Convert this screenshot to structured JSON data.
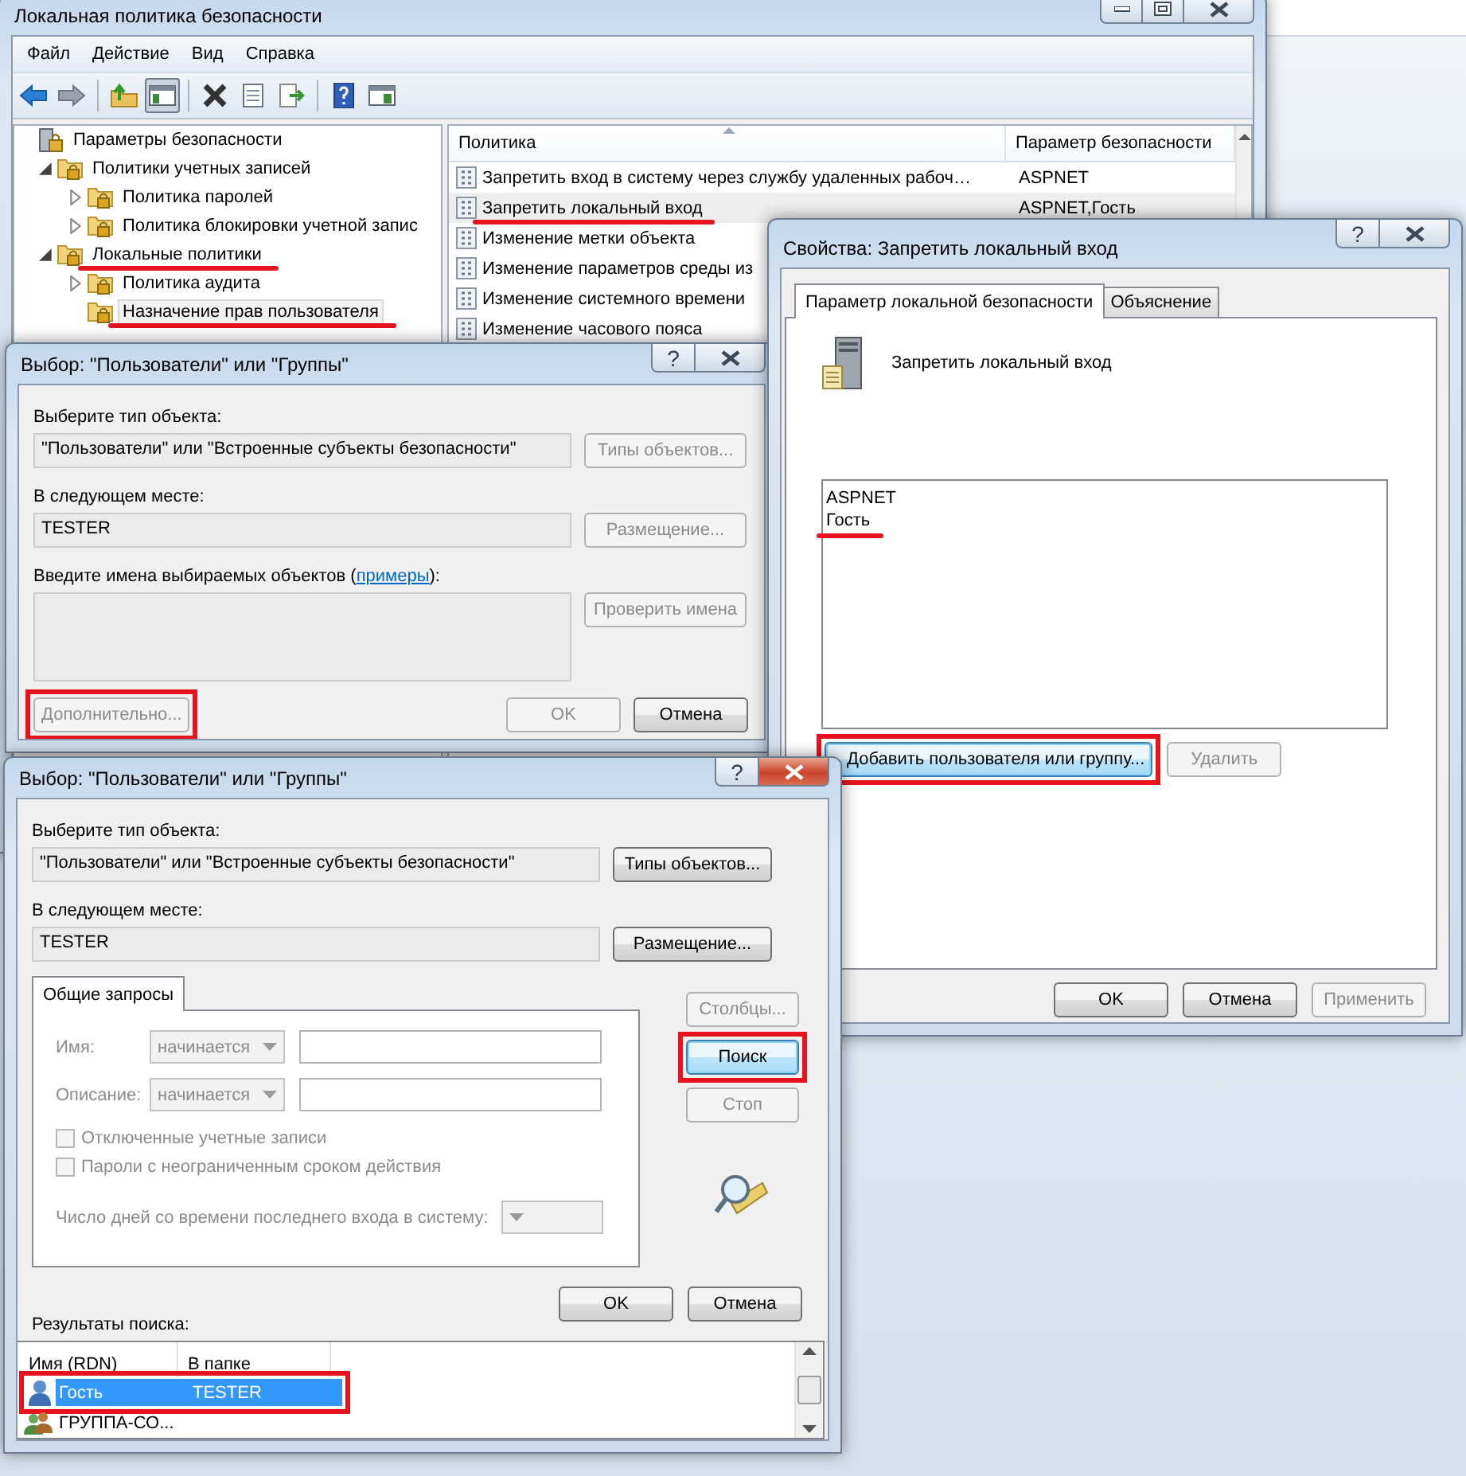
{
  "main_window": {
    "title": "Локальная политика безопасности",
    "menu": [
      "Файл",
      "Действие",
      "Вид",
      "Справка"
    ],
    "toolbar": [
      {
        "kind": "back",
        "pressed": false
      },
      {
        "kind": "forward",
        "pressed": false
      },
      {
        "kind": "separator"
      },
      {
        "kind": "up",
        "pressed": false
      },
      {
        "kind": "tree",
        "pressed": true
      },
      {
        "kind": "separator"
      },
      {
        "kind": "delete",
        "pressed": false
      },
      {
        "kind": "properties",
        "pressed": false
      },
      {
        "kind": "export",
        "pressed": false
      },
      {
        "kind": "separator"
      },
      {
        "kind": "help",
        "pressed": false
      },
      {
        "kind": "panel",
        "pressed": false
      }
    ],
    "tree": [
      {
        "label": "Параметры безопасности",
        "selected": false,
        "children": [
          {
            "label": "Политики учетных записей",
            "expanded": true,
            "selected": false,
            "children": [
              {
                "label": "Политика паролей",
                "expanded": false,
                "selected": false
              },
              {
                "label": "Политика блокировки учетной запис",
                "expanded": false,
                "selected": false
              }
            ]
          },
          {
            "label": "Локальные политики",
            "expanded": true,
            "selected": false,
            "marked": true,
            "children": [
              {
                "label": "Политика аудита",
                "expanded": false,
                "selected": false
              },
              {
                "label": "Назначение прав пользователя",
                "selected": true,
                "marked": true
              }
            ]
          }
        ]
      }
    ],
    "table": {
      "columns": [
        "Политика",
        "Параметр безопасности"
      ],
      "rows": [
        {
          "policy": "Запретить вход в систему через службу удаленных рабоч…",
          "setting": "ASPNET",
          "selected": false
        },
        {
          "policy": "Запретить локальный вход",
          "setting": "ASPNET,Гость",
          "selected": true,
          "marked": true
        },
        {
          "policy": "Изменение метки объекта",
          "selected": false
        },
        {
          "policy": "Изменение параметров среды из",
          "selected": false
        },
        {
          "policy": "Изменение системного времени",
          "selected": false
        },
        {
          "policy": "Изменение часового пояса",
          "selected": false
        }
      ]
    }
  },
  "select_dialog": {
    "title": "Выбор: \"Пользователи\" или \"Группы\"",
    "help_glyph": "?",
    "active": false,
    "object_type": {
      "label": "Выберите тип объекта:",
      "value": "\"Пользователи\" или \"Встроенные субъекты безопасности\"",
      "button": {
        "label": "Типы объектов...",
        "disabled": true,
        "focused": false
      }
    },
    "location": {
      "label": "В следующем месте:",
      "value": "TESTER",
      "button": {
        "label": "Размещение...",
        "disabled": true,
        "focused": false
      }
    },
    "names": {
      "label_start": "Введите имена выбираемых объектов (",
      "link": "примеры",
      "label_end": "):",
      "button": {
        "label": "Проверить имена",
        "disabled": true,
        "focused": false
      }
    },
    "advanced": {
      "label": "Дополнительно...",
      "disabled": true,
      "focused": false,
      "framed": true
    },
    "ok": {
      "label": "OK",
      "disabled": true,
      "focused": false
    },
    "cancel": {
      "label": "Отмена",
      "disabled": false,
      "focused": false
    }
  },
  "properties_dialog": {
    "title": "Свойства: Запретить локальный вход",
    "help_glyph": "?",
    "active": false,
    "tabs": [
      {
        "label": "Параметр локальной безопасности",
        "selected": true
      },
      {
        "label": "Объяснение",
        "selected": false
      }
    ],
    "policy_name": "Запретить локальный вход",
    "members": [
      {
        "name": "ASPNET"
      },
      {
        "name": "Гость",
        "marked": true
      }
    ],
    "add": {
      "label": "Добавить пользователя или группу...",
      "disabled": false,
      "focused": true,
      "framed": true
    },
    "remove": {
      "label": "Удалить",
      "disabled": true,
      "focused": false
    },
    "buttons": [
      {
        "label": "OK",
        "disabled": false,
        "focused": false
      },
      {
        "label": "Отмена",
        "disabled": false,
        "focused": false
      },
      {
        "label": "Применить",
        "disabled": true,
        "focused": false
      }
    ]
  },
  "search_dialog": {
    "title": "Выбор: \"Пользователи\" или \"Группы\"",
    "help_glyph": "?",
    "active": true,
    "object_type": {
      "label": "Выберите тип объекта:",
      "value": "\"Пользователи\" или \"Встроенные субъекты безопасности\"",
      "button": {
        "label": "Типы объектов...",
        "disabled": false,
        "focused": false
      }
    },
    "location": {
      "label": "В следующем месте:",
      "value": "TESTER",
      "button": {
        "label": "Размещение...",
        "disabled": false,
        "focused": false
      }
    },
    "tabs": [
      {
        "label": "Общие запросы",
        "selected": true
      }
    ],
    "query": {
      "disabled": true,
      "fields": [
        {
          "label": "Имя:",
          "operator": "начинается"
        },
        {
          "label": "Описание:",
          "operator": "начинается"
        }
      ],
      "checkboxes": [
        {
          "label": "Отключенные учетные записи",
          "checked": false
        },
        {
          "label": "Пароли с неограниченным сроком действия",
          "checked": false
        }
      ],
      "days_label": "Число дней со времени последнего входа в систему:"
    },
    "side_buttons": [
      {
        "label": "Столбцы...",
        "disabled": true,
        "focused": false
      },
      {
        "label": "Поиск",
        "disabled": false,
        "focused": true,
        "framed": true
      },
      {
        "label": "Стоп",
        "disabled": true,
        "focused": false
      }
    ],
    "ok": {
      "label": "OK",
      "disabled": false,
      "focused": false
    },
    "cancel": {
      "label": "Отмена",
      "disabled": false,
      "focused": false
    },
    "results_label": "Результаты поиска:",
    "results": {
      "columns": [
        "Имя (RDN)",
        "В папке"
      ],
      "rows": [
        {
          "kind": "user",
          "name": "Гость",
          "folder": "TESTER",
          "selected": true,
          "framed": true
        },
        {
          "kind": "group",
          "name": "ГРУППА-СО...",
          "selected": false
        }
      ]
    }
  }
}
